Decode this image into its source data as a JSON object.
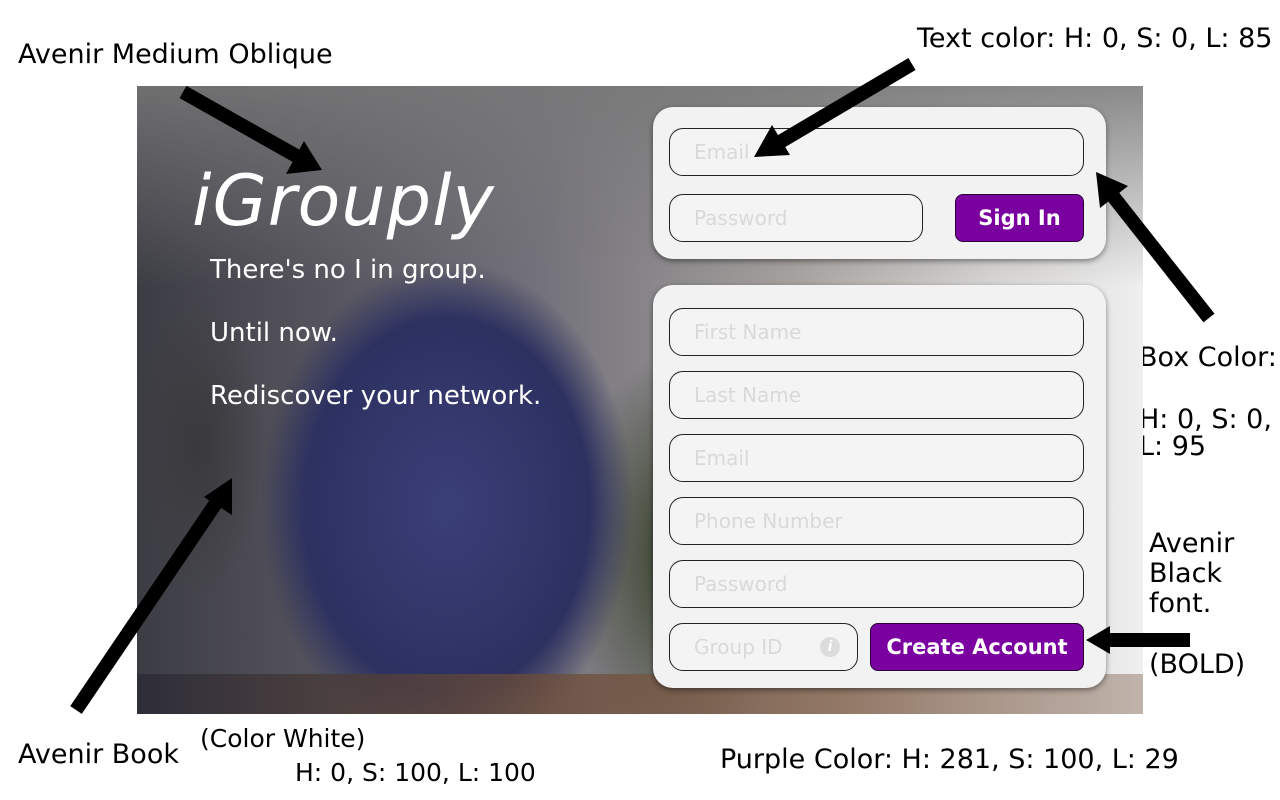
{
  "annotations": {
    "title_font": "Avenir Medium Oblique",
    "text_color": "Text color: H: 0, S: 0, L: 85",
    "box_color_title": "Box Color:",
    "box_color_line1": "H: 0, S: 0,",
    "box_color_line2": "L: 95",
    "button_font_line1": "Avenir",
    "button_font_line2": "Black",
    "button_font_line3": "font.",
    "button_font_bold": "(BOLD)",
    "body_font": "Avenir Book",
    "white_color_line1": "(Color White)",
    "white_color_line2": "H: 0, S: 100, L: 100",
    "purple_color": "Purple Color:  H: 281, S: 100, L: 29"
  },
  "hero": {
    "logo": "iGrouply",
    "tagline1": "There's no I in group.",
    "tagline2": "Until now.",
    "tagline3": "Rediscover your network."
  },
  "signin": {
    "email_placeholder": "Email",
    "password_placeholder": "Password",
    "button_label": "Sign In"
  },
  "signup": {
    "first_name_placeholder": "First Name",
    "last_name_placeholder": "Last Name",
    "email_placeholder": "Email",
    "phone_placeholder": "Phone Number",
    "password_placeholder": "Password",
    "group_id_placeholder": "Group ID",
    "info_icon_glyph": "i",
    "button_label": "Create Account"
  },
  "colors": {
    "purple": "#7a00a0",
    "box": "#f2f2f2",
    "placeholder_text": "#d9d9d9",
    "white": "#ffffff"
  }
}
